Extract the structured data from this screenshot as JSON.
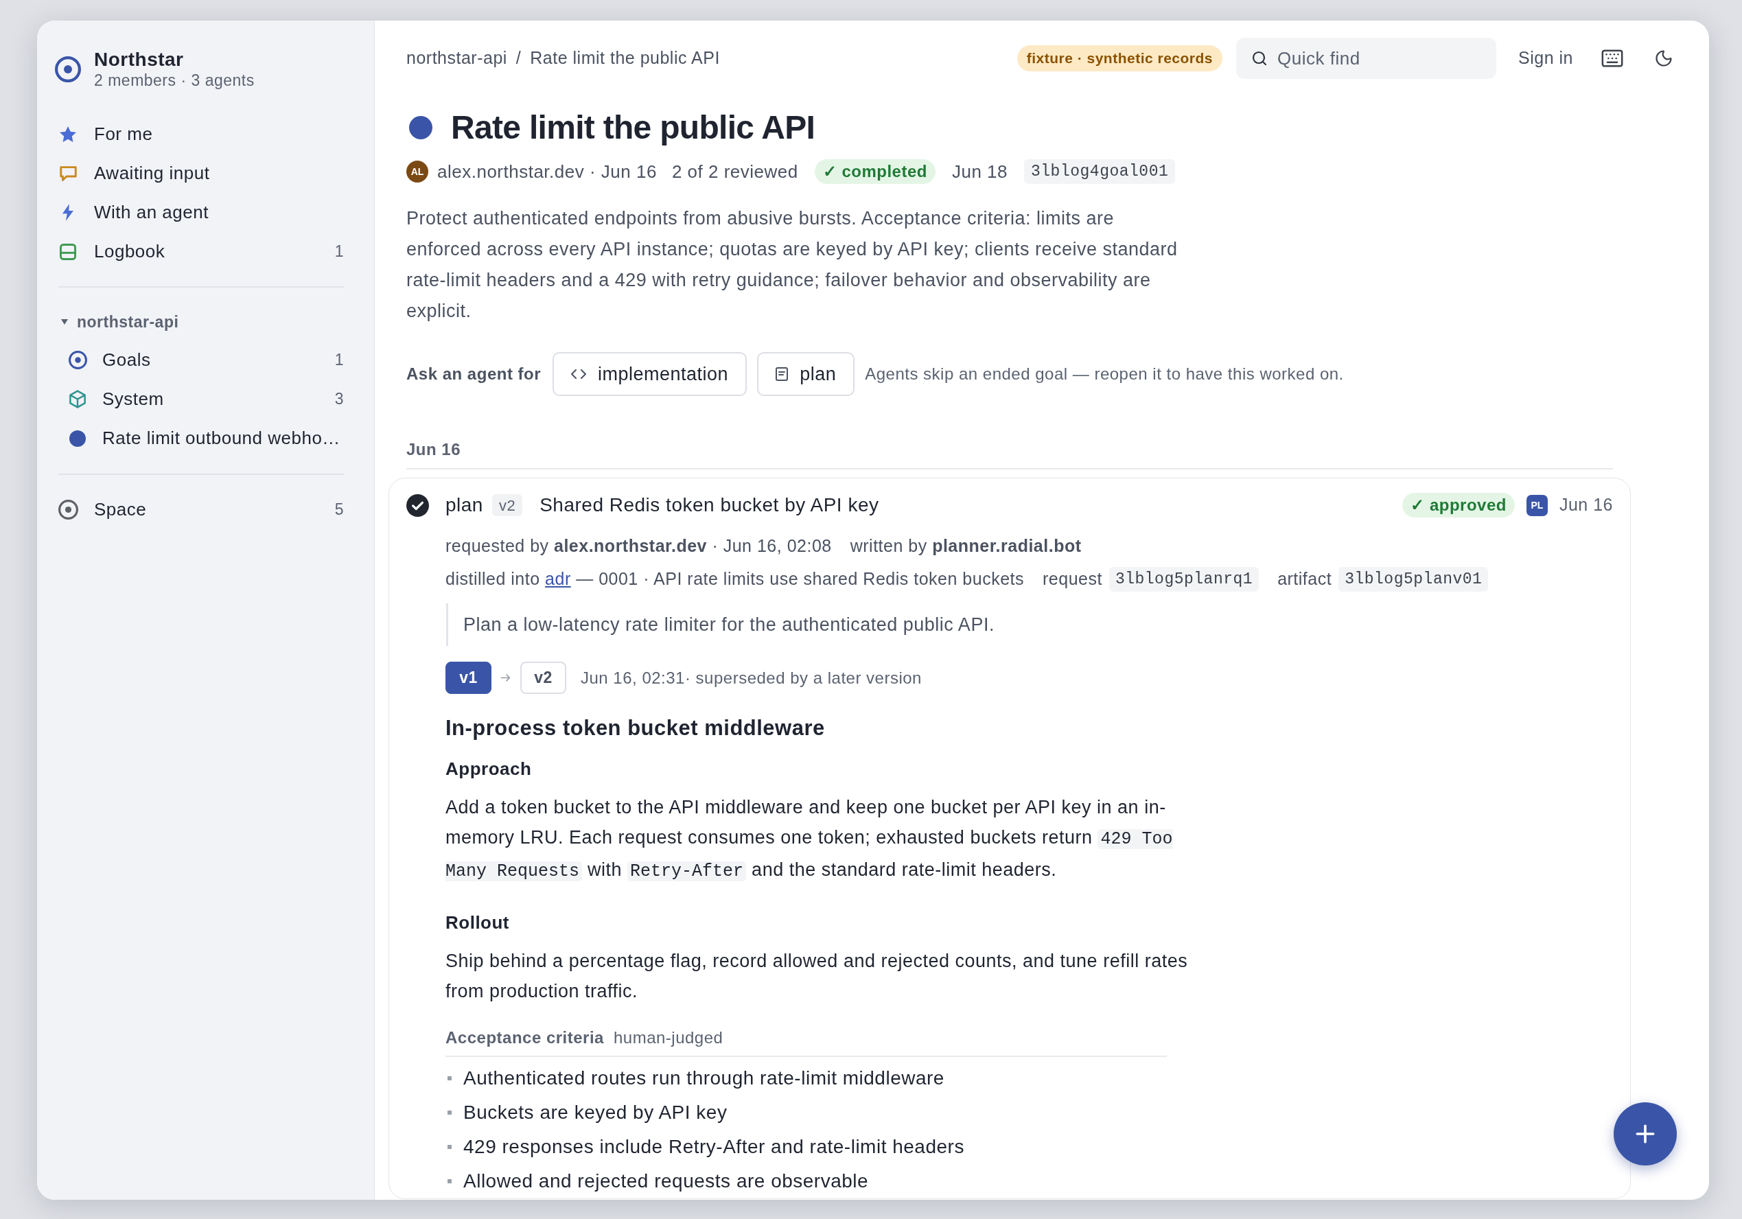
{
  "workspace": {
    "name": "Northstar",
    "summary": "2 members · 3 agents"
  },
  "nav": [
    {
      "kind": "star",
      "label": "For me"
    },
    {
      "kind": "chat",
      "label": "Awaiting input"
    },
    {
      "kind": "bolt",
      "label": "With an agent"
    },
    {
      "kind": "logbook",
      "label": "Logbook",
      "count": "1"
    }
  ],
  "project": {
    "name": "northstar-api",
    "expanded": true,
    "items": [
      {
        "kind": "goals",
        "label": "Goals",
        "count": "1"
      },
      {
        "kind": "system",
        "label": "System",
        "count": "3"
      },
      {
        "kind": "goal",
        "label": "Rate limit outbound webho…"
      }
    ]
  },
  "spaces": [
    {
      "kind": "space",
      "label": "Space",
      "count": "5"
    }
  ],
  "header": {
    "breadcrumb": [
      "northstar-api",
      "Rate limit the public API"
    ],
    "separator": "/",
    "badge": "fixture · synthetic records",
    "search": {
      "placeholder": "Quick find"
    },
    "sign_in": "Sign in"
  },
  "goal": {
    "title": "Rate limit the public API",
    "avatar": "AL",
    "byline": "alex.northstar.dev · Jun 16",
    "reviewed": "2 of 2 reviewed",
    "status": "✓ completed",
    "due": "Jun 18",
    "id": "3lblog4goal001",
    "description": "Protect authenticated endpoints from abusive bursts. Acceptance criteria: limits are enforced across every API instance; quotas are keyed by API key; clients receive standard rate-limit headers and a 429 with retry guidance; failover behavior and observability are explicit."
  },
  "ask_agent": {
    "label": "Ask an agent for",
    "actions": [
      {
        "kind": "code",
        "label": "implementation"
      },
      {
        "kind": "doc",
        "label": "plan"
      }
    ],
    "note": "Agents skip an ended goal — reopen it to have this worked on."
  },
  "timeline": [
    {
      "date": "Jun 16",
      "entries": [
        {
          "done": true,
          "kind_label": "plan",
          "version": "v2",
          "title": "Shared Redis token bucket by API key",
          "status": "✓ approved",
          "avatar": "PL",
          "date": "Jun 16",
          "requested": "requested by **alex.northstar.dev** · Jun 16, 02:08",
          "written": "written by **planner.radial.bot**",
          "distilled": {
            "prefix": "distilled into",
            "link": "adr",
            "rest": "— 0001 · API rate limits use shared Redis token buckets"
          },
          "refs": [
            {
              "label": "request",
              "id": "3lblog5planrq1"
            },
            {
              "label": "artifact",
              "id": "3lblog5planv01"
            }
          ],
          "prompt": "Plan a low-latency rate limiter for the authenticated public API.",
          "versions": [
            {
              "label": "v1",
              "selected": true
            },
            {
              "label": "v2",
              "selected": false
            }
          ],
          "version_note": "Jun 16, 02:31· superseded by a later version",
          "doc": {
            "heading": "In-process token bucket middleware",
            "sections": [
              {
                "heading": "Approach",
                "body": [
                  {
                    "kind": "text",
                    "text": "Add a token bucket to the API middleware and keep one bucket per API key in an in-memory LRU. Each request consumes one token; exhausted buckets return "
                  },
                  {
                    "kind": "code",
                    "text": "429 Too Many Requests"
                  },
                  {
                    "kind": "text",
                    "text": " with "
                  },
                  {
                    "kind": "code",
                    "text": "Retry-After"
                  },
                  {
                    "kind": "text",
                    "text": " and the standard rate-limit headers."
                  }
                ]
              },
              {
                "heading": "Rollout",
                "body": [
                  {
                    "kind": "text",
                    "text": "Ship behind a percentage flag, record allowed and rejected counts, and tune refill rates from production traffic."
                  }
                ]
              }
            ],
            "criteria": {
              "label": "Acceptance criteria",
              "mode": "human-judged",
              "items": [
                "Authenticated routes run through rate-limit middleware",
                "Buckets are keyed by API key",
                "429 responses include Retry-After and rate-limit headers",
                "Allowed and rejected requests are observable"
              ]
            }
          }
        }
      ]
    }
  ]
}
